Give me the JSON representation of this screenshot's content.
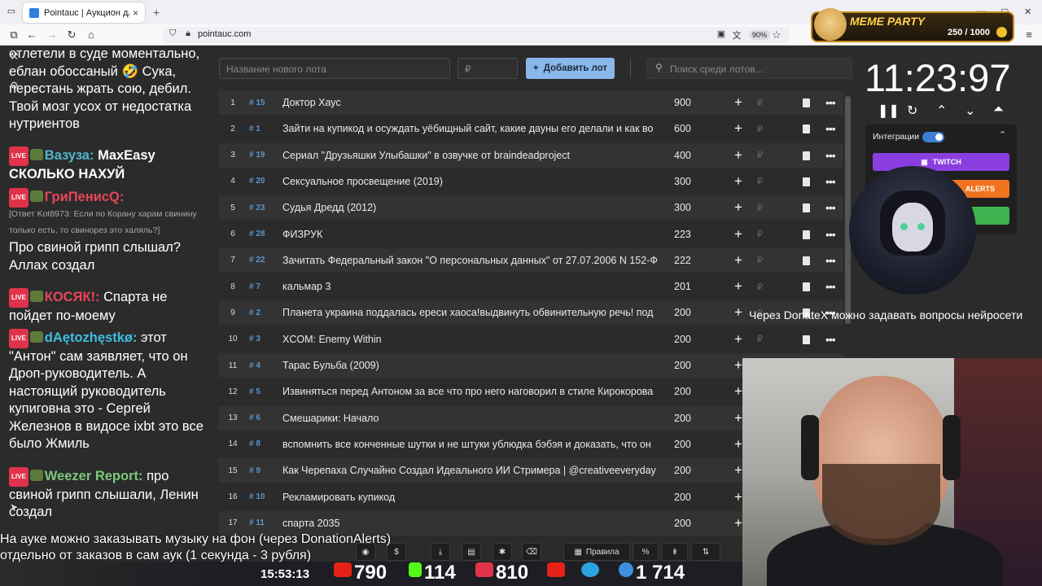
{
  "browser": {
    "tab_title": "Pointauc | Аукцион для стриме",
    "url": "pointauc.com",
    "zoom": "90%"
  },
  "meme_party": {
    "title": "MEME PARTY",
    "count": "250 / 1000"
  },
  "chat": {
    "messages": [
      {
        "text": "отлетели в суде моментально, еблан обоссаный 🤣 Сука, перестань жрать сою, дебил. Твой мозг усох от недостатка нутриентов"
      },
      {
        "user": "Вазуза:",
        "text": "MaxEasy СКОЛЬКО НАХУЙ"
      },
      {
        "user": "ГриПенисQ:",
        "reply": "[Ответ Kot8973: Если по Корану харам свинину только есть, то свинорез это халяль?]",
        "text": "Про свиной грипп слышал? Аллах создал"
      },
      {
        "user": "КОСЯК!:",
        "text": "Спарта не пойдет по-моему"
      },
      {
        "user": "dAętozhęstkø:",
        "text": "этот \"Антон\" сам заявляет, что он Дроп-руководитель. А настоящий руководитель купиговна это - Сергей Железнов        в видосе ixbt это все было Жмиль"
      },
      {
        "user": "Weezer Report:",
        "text": "про свиной грипп слышали, Ленин создал"
      }
    ]
  },
  "lot_form": {
    "name_placeholder": "Название нового лота",
    "amount_placeholder": "₽",
    "add_label": "Добавить лот",
    "search_placeholder": "Поиск среди лотов..."
  },
  "lots": [
    {
      "n": "1",
      "id": "# 15",
      "name": "Доктор Хаус",
      "amount": "900"
    },
    {
      "n": "2",
      "id": "# 1",
      "name": "Зайти на купикод и осуждать уёбищный сайт, какие дауны его делали и как во",
      "amount": "600"
    },
    {
      "n": "3",
      "id": "# 19",
      "name": "Сериал \"Друзьяшки Улыбашки\" в озвучке от braindeadproject",
      "amount": "400"
    },
    {
      "n": "4",
      "id": "# 20",
      "name": "Сексуальное просвещение (2019)",
      "amount": "300"
    },
    {
      "n": "5",
      "id": "# 23",
      "name": "Судья Дредд (2012)",
      "amount": "300"
    },
    {
      "n": "6",
      "id": "# 28",
      "name": "ФИЗРУК",
      "amount": "223"
    },
    {
      "n": "7",
      "id": "# 22",
      "name": "Зачитать Федеральный закон \"О персональных данных\" от 27.07.2006 N 152-Ф",
      "amount": "222"
    },
    {
      "n": "8",
      "id": "# 7",
      "name": "кальмар 3",
      "amount": "201"
    },
    {
      "n": "9",
      "id": "# 2",
      "name": "Планета украина поддалась ереси хаоса!выдвинуть обвинительную речь! под",
      "amount": "200"
    },
    {
      "n": "10",
      "id": "# 3",
      "name": "XCOM: Enemy Within",
      "amount": "200"
    },
    {
      "n": "11",
      "id": "# 4",
      "name": "Тарас Бульба (2009)",
      "amount": "200"
    },
    {
      "n": "12",
      "id": "# 5",
      "name": "Извиняться перед Антоном за все что про него наговорил в стиле Кирокорова",
      "amount": "200"
    },
    {
      "n": "13",
      "id": "# 6",
      "name": "Смешарики: Начало",
      "amount": "200"
    },
    {
      "n": "14",
      "id": "# 8",
      "name": "вспомнить все конченные шутки и не штуки ублюдка бэбэя и доказать, что он",
      "amount": "200"
    },
    {
      "n": "15",
      "id": "# 9",
      "name": "Как Черепаха Случайно Создал Идеального ИИ Стримера | @creativeeveryday",
      "amount": "200"
    },
    {
      "n": "16",
      "id": "# 10",
      "name": "Рекламировать купикод",
      "amount": "200"
    },
    {
      "n": "17",
      "id": "# 11",
      "name": "спарта 2035",
      "amount": "200"
    }
  ],
  "timer": {
    "value": "11:23:97"
  },
  "integrations": {
    "label": "Интеграции",
    "twitch": "TWITCH",
    "da": "ALERTS",
    "third": ""
  },
  "donatex_text": "Через DonateX можно задавать вопросы нейросети",
  "bottom_text": {
    "line1": "На ауке можно заказывать музыку на фон (через DonationAlerts)",
    "line2": "отдельно от заказов в сам аук (1 секунда - 3 рубля)"
  },
  "toolbar": {
    "rules": "Правила",
    "percent": "%"
  },
  "stats": {
    "clock": "15:53:13",
    "youtube": "790",
    "kick": "114",
    "vk": "810",
    "telegram": "",
    "viewers": "1 714"
  }
}
